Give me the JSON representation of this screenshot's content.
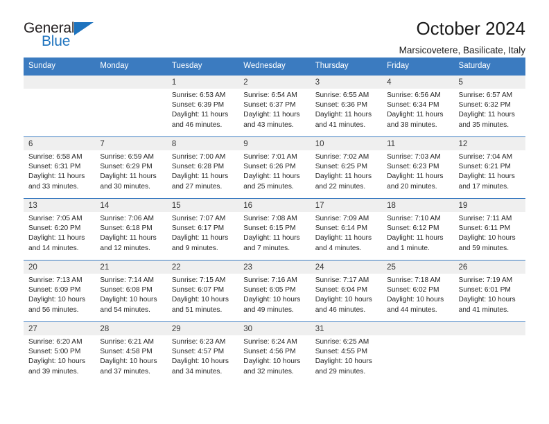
{
  "brand": {
    "name_top": "General",
    "name_bottom": "Blue",
    "triangle_color": "#1e73be"
  },
  "header": {
    "title": "October 2024",
    "subtitle": "Marsicovetere, Basilicate, Italy"
  },
  "theme": {
    "header_blue": "#3b7bc0",
    "day_strip_gray": "#efefef",
    "text": "#262626"
  },
  "weekdays": [
    "Sunday",
    "Monday",
    "Tuesday",
    "Wednesday",
    "Thursday",
    "Friday",
    "Saturday"
  ],
  "weeks": [
    [
      {
        "day": "",
        "empty": true,
        "sunrise": "",
        "sunset": "",
        "daylight": ""
      },
      {
        "day": "",
        "empty": true,
        "sunrise": "",
        "sunset": "",
        "daylight": ""
      },
      {
        "day": "1",
        "sunrise": "Sunrise: 6:53 AM",
        "sunset": "Sunset: 6:39 PM",
        "daylight": "Daylight: 11 hours and 46 minutes."
      },
      {
        "day": "2",
        "sunrise": "Sunrise: 6:54 AM",
        "sunset": "Sunset: 6:37 PM",
        "daylight": "Daylight: 11 hours and 43 minutes."
      },
      {
        "day": "3",
        "sunrise": "Sunrise: 6:55 AM",
        "sunset": "Sunset: 6:36 PM",
        "daylight": "Daylight: 11 hours and 41 minutes."
      },
      {
        "day": "4",
        "sunrise": "Sunrise: 6:56 AM",
        "sunset": "Sunset: 6:34 PM",
        "daylight": "Daylight: 11 hours and 38 minutes."
      },
      {
        "day": "5",
        "sunrise": "Sunrise: 6:57 AM",
        "sunset": "Sunset: 6:32 PM",
        "daylight": "Daylight: 11 hours and 35 minutes."
      }
    ],
    [
      {
        "day": "6",
        "sunrise": "Sunrise: 6:58 AM",
        "sunset": "Sunset: 6:31 PM",
        "daylight": "Daylight: 11 hours and 33 minutes."
      },
      {
        "day": "7",
        "sunrise": "Sunrise: 6:59 AM",
        "sunset": "Sunset: 6:29 PM",
        "daylight": "Daylight: 11 hours and 30 minutes."
      },
      {
        "day": "8",
        "sunrise": "Sunrise: 7:00 AM",
        "sunset": "Sunset: 6:28 PM",
        "daylight": "Daylight: 11 hours and 27 minutes."
      },
      {
        "day": "9",
        "sunrise": "Sunrise: 7:01 AM",
        "sunset": "Sunset: 6:26 PM",
        "daylight": "Daylight: 11 hours and 25 minutes."
      },
      {
        "day": "10",
        "sunrise": "Sunrise: 7:02 AM",
        "sunset": "Sunset: 6:25 PM",
        "daylight": "Daylight: 11 hours and 22 minutes."
      },
      {
        "day": "11",
        "sunrise": "Sunrise: 7:03 AM",
        "sunset": "Sunset: 6:23 PM",
        "daylight": "Daylight: 11 hours and 20 minutes."
      },
      {
        "day": "12",
        "sunrise": "Sunrise: 7:04 AM",
        "sunset": "Sunset: 6:21 PM",
        "daylight": "Daylight: 11 hours and 17 minutes."
      }
    ],
    [
      {
        "day": "13",
        "sunrise": "Sunrise: 7:05 AM",
        "sunset": "Sunset: 6:20 PM",
        "daylight": "Daylight: 11 hours and 14 minutes."
      },
      {
        "day": "14",
        "sunrise": "Sunrise: 7:06 AM",
        "sunset": "Sunset: 6:18 PM",
        "daylight": "Daylight: 11 hours and 12 minutes."
      },
      {
        "day": "15",
        "sunrise": "Sunrise: 7:07 AM",
        "sunset": "Sunset: 6:17 PM",
        "daylight": "Daylight: 11 hours and 9 minutes."
      },
      {
        "day": "16",
        "sunrise": "Sunrise: 7:08 AM",
        "sunset": "Sunset: 6:15 PM",
        "daylight": "Daylight: 11 hours and 7 minutes."
      },
      {
        "day": "17",
        "sunrise": "Sunrise: 7:09 AM",
        "sunset": "Sunset: 6:14 PM",
        "daylight": "Daylight: 11 hours and 4 minutes."
      },
      {
        "day": "18",
        "sunrise": "Sunrise: 7:10 AM",
        "sunset": "Sunset: 6:12 PM",
        "daylight": "Daylight: 11 hours and 1 minute."
      },
      {
        "day": "19",
        "sunrise": "Sunrise: 7:11 AM",
        "sunset": "Sunset: 6:11 PM",
        "daylight": "Daylight: 10 hours and 59 minutes."
      }
    ],
    [
      {
        "day": "20",
        "sunrise": "Sunrise: 7:13 AM",
        "sunset": "Sunset: 6:09 PM",
        "daylight": "Daylight: 10 hours and 56 minutes."
      },
      {
        "day": "21",
        "sunrise": "Sunrise: 7:14 AM",
        "sunset": "Sunset: 6:08 PM",
        "daylight": "Daylight: 10 hours and 54 minutes."
      },
      {
        "day": "22",
        "sunrise": "Sunrise: 7:15 AM",
        "sunset": "Sunset: 6:07 PM",
        "daylight": "Daylight: 10 hours and 51 minutes."
      },
      {
        "day": "23",
        "sunrise": "Sunrise: 7:16 AM",
        "sunset": "Sunset: 6:05 PM",
        "daylight": "Daylight: 10 hours and 49 minutes."
      },
      {
        "day": "24",
        "sunrise": "Sunrise: 7:17 AM",
        "sunset": "Sunset: 6:04 PM",
        "daylight": "Daylight: 10 hours and 46 minutes."
      },
      {
        "day": "25",
        "sunrise": "Sunrise: 7:18 AM",
        "sunset": "Sunset: 6:02 PM",
        "daylight": "Daylight: 10 hours and 44 minutes."
      },
      {
        "day": "26",
        "sunrise": "Sunrise: 7:19 AM",
        "sunset": "Sunset: 6:01 PM",
        "daylight": "Daylight: 10 hours and 41 minutes."
      }
    ],
    [
      {
        "day": "27",
        "sunrise": "Sunrise: 6:20 AM",
        "sunset": "Sunset: 5:00 PM",
        "daylight": "Daylight: 10 hours and 39 minutes."
      },
      {
        "day": "28",
        "sunrise": "Sunrise: 6:21 AM",
        "sunset": "Sunset: 4:58 PM",
        "daylight": "Daylight: 10 hours and 37 minutes."
      },
      {
        "day": "29",
        "sunrise": "Sunrise: 6:23 AM",
        "sunset": "Sunset: 4:57 PM",
        "daylight": "Daylight: 10 hours and 34 minutes."
      },
      {
        "day": "30",
        "sunrise": "Sunrise: 6:24 AM",
        "sunset": "Sunset: 4:56 PM",
        "daylight": "Daylight: 10 hours and 32 minutes."
      },
      {
        "day": "31",
        "sunrise": "Sunrise: 6:25 AM",
        "sunset": "Sunset: 4:55 PM",
        "daylight": "Daylight: 10 hours and 29 minutes."
      },
      {
        "day": "",
        "empty": true,
        "sunrise": "",
        "sunset": "",
        "daylight": ""
      },
      {
        "day": "",
        "empty": true,
        "sunrise": "",
        "sunset": "",
        "daylight": ""
      }
    ]
  ]
}
